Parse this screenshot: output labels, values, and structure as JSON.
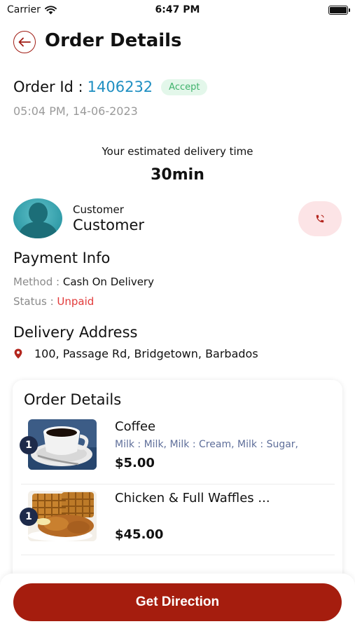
{
  "status_bar": {
    "carrier": "Carrier",
    "time": "6:47 PM"
  },
  "header": {
    "title": "Order Details",
    "back_icon": "arrow-left-icon"
  },
  "order": {
    "id_label": "Order Id :",
    "id_value": "1406232",
    "status": "Accept",
    "datetime": "05:04 PM, 14-06-2023"
  },
  "delivery_estimate": {
    "label": "Your estimated delivery time",
    "value": "30min"
  },
  "customer": {
    "role": "Customer",
    "name": "Customer",
    "call_icon": "phone-icon"
  },
  "payment": {
    "title": "Payment Info",
    "method_label": "Method :",
    "method_value": "Cash On Delivery",
    "status_label": "Status :",
    "status_value": "Unpaid"
  },
  "address": {
    "title": "Delivery Address",
    "text": "100, Passage Rd, Bridgetown, Barbados",
    "icon": "location-pin-icon"
  },
  "order_card": {
    "title": "Order Details",
    "items": [
      {
        "qty": "1",
        "name": "Coffee",
        "addons": "Milk : Milk, Milk : Cream, Milk : Sugar,",
        "price": "$5.00"
      },
      {
        "qty": "1",
        "name": "Chicken & Full Waffles ...",
        "addons": "",
        "price": "$45.00"
      }
    ]
  },
  "footer": {
    "button_label": "Get Direction"
  },
  "colors": {
    "brand": "#a51d0e",
    "link": "#1f8fc2",
    "accept_bg": "#e3f7ea",
    "accept_text": "#3fb26b",
    "unpaid": "#e23a3a"
  }
}
